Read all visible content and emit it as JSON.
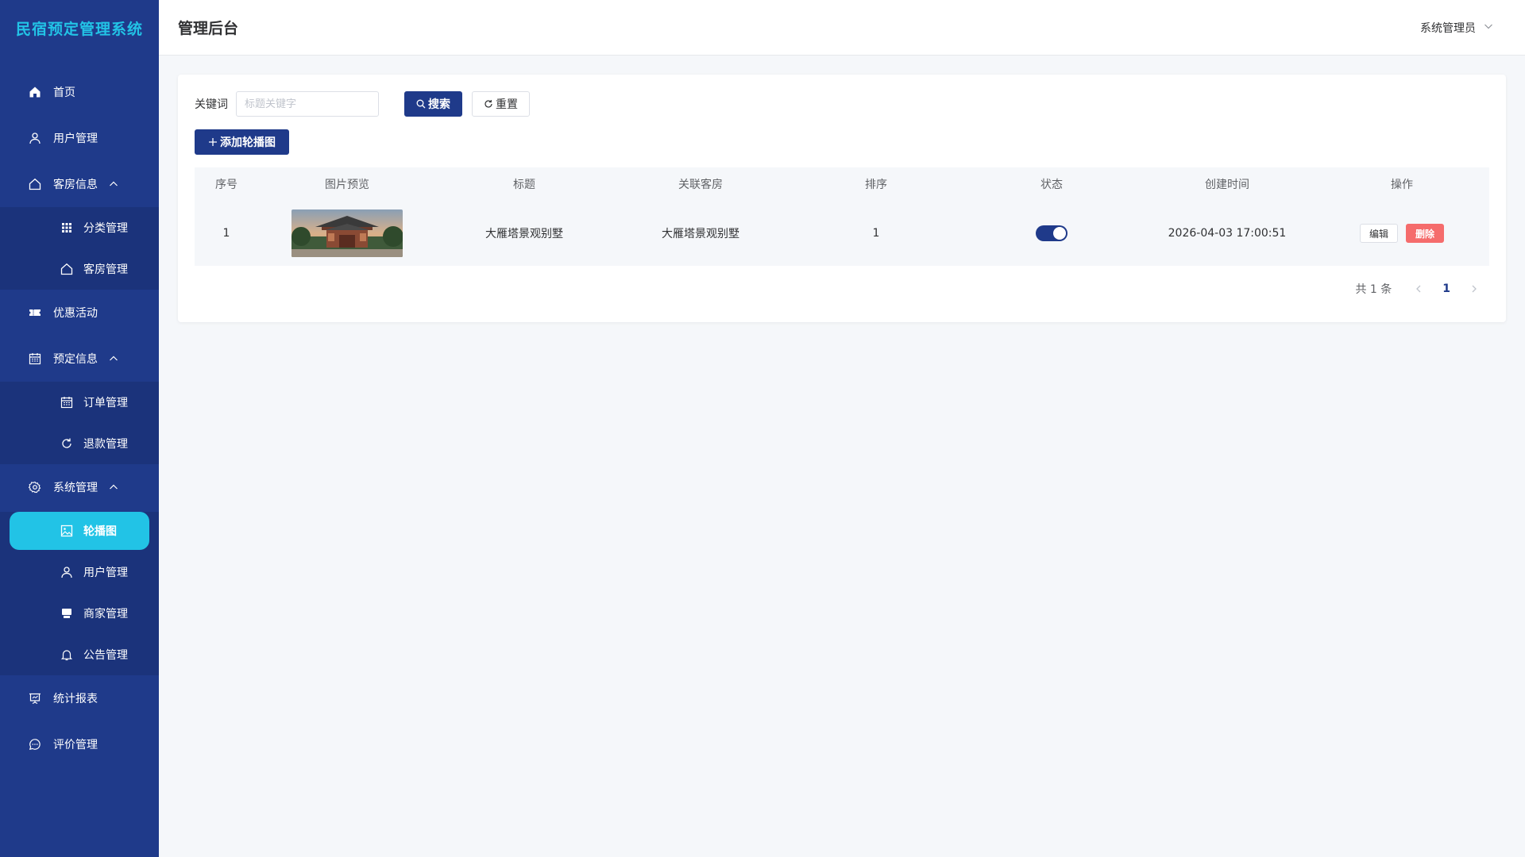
{
  "app": {
    "logo": "民宿预定管理系统",
    "header_title": "管理后台",
    "user": "系统管理员"
  },
  "sidebar": {
    "home": "首页",
    "user_mgmt": "用户管理",
    "room_info": "客房信息",
    "room_sub": {
      "category": "分类管理",
      "rooms": "客房管理"
    },
    "promo": "优惠活动",
    "booking": "预定信息",
    "booking_sub": {
      "orders": "订单管理",
      "refunds": "退款管理"
    },
    "system": "系统管理",
    "system_sub": {
      "carousel": "轮播图",
      "users": "用户管理",
      "merchants": "商家管理",
      "notices": "公告管理"
    },
    "stats": "统计报表",
    "reviews": "评价管理"
  },
  "search": {
    "label": "关键词",
    "placeholder": "标题关键字",
    "value": "",
    "search_btn": "搜索",
    "reset_btn": "重置",
    "add_btn": "添加轮播图"
  },
  "table": {
    "headers": {
      "idx": "序号",
      "image": "图片预览",
      "title": "标题",
      "room": "关联客房",
      "sort": "排序",
      "status": "状态",
      "created": "创建时间",
      "op": "操作"
    },
    "rows": [
      {
        "idx": "1",
        "title": "大雁塔景观别墅",
        "room": "大雁塔景观别墅",
        "sort": "1",
        "status_on": true,
        "created": "2026-04-03 17:00:51",
        "edit": "编辑",
        "delete": "删除"
      }
    ]
  },
  "pagination": {
    "total": "共 1 条",
    "current": "1"
  },
  "colors": {
    "sidebar": "#1f3a8a",
    "accent": "#22c3e6",
    "primary": "#1f3a8a",
    "danger": "#f56c6c"
  }
}
